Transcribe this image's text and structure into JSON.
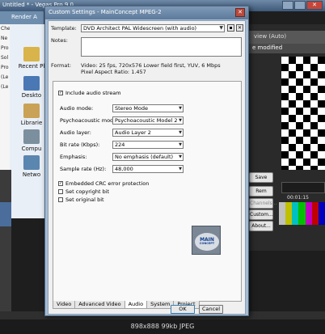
{
  "host": {
    "title": "Untitled * - Vegas Pro 9.0",
    "render_title": "Render A",
    "left_nav": [
      "Che",
      "Ne",
      "Pro",
      "Sol",
      "Pro",
      "(Le",
      "(Le"
    ],
    "places": [
      "Recent Pl",
      "Deskto",
      "Librarie",
      "Compu",
      "Netwo"
    ],
    "preview_label": "view (Auto)",
    "modified_label": "e modified",
    "side_buttons": [
      "Save",
      "Rem",
      "Channels...",
      "Custom...",
      "About..."
    ],
    "timecode": "00:01:15"
  },
  "dialog": {
    "title": "Custom Settings - MainConcept MPEG-2",
    "template_label": "Template:",
    "template_value": "DVD Architect PAL Widescreen (with audio)",
    "notes_label": "Notes:",
    "format_label": "Format:",
    "format_lines": [
      "Video: 25 fps, 720x576 Lower field first, YUV, 6 Mbps",
      "Pixel Aspect Ratio: 1.457"
    ],
    "include_audio": {
      "label": "Include audio stream",
      "checked": true
    },
    "fields": [
      {
        "label": "Audio mode:",
        "value": "Stereo Mode"
      },
      {
        "label": "Psychoacoustic model:",
        "value": "Psychoacoustic Model 2"
      },
      {
        "label": "Audio layer:",
        "value": "Audio Layer 2"
      },
      {
        "label": "Bit rate (Kbps):",
        "value": "224"
      },
      {
        "label": "Emphasis:",
        "value": "No emphasis (default)"
      },
      {
        "label": "Sample rate (Hz):",
        "value": "48,000"
      }
    ],
    "options": [
      {
        "label": "Embedded CRC error protection",
        "checked": true
      },
      {
        "label": "Set copyright bit",
        "checked": false
      },
      {
        "label": "Set original bit",
        "checked": false
      }
    ],
    "logo_text": [
      "MAIN",
      "CONCEPT"
    ],
    "tabs": [
      "Video",
      "Advanced Video",
      "Audio",
      "System",
      "Project"
    ],
    "active_tab": "Audio",
    "ok_label": "OK",
    "cancel_label": "Cancel"
  },
  "caption": "898x888 99kb JPEG",
  "colors": {
    "title_bar": "#5d7a9c",
    "dialog_frame": "#a6bcd2",
    "close_button": "#b94a3d"
  }
}
